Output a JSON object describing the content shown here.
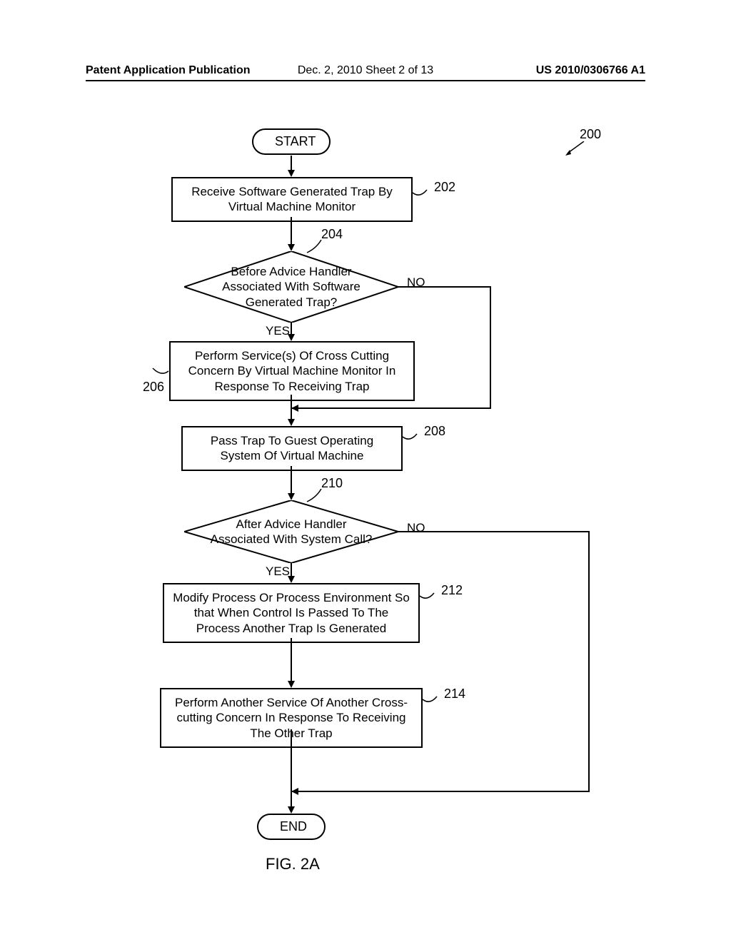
{
  "header": {
    "left": "Patent Application Publication",
    "center": "Dec. 2, 2010  Sheet 2 of 13",
    "right": "US 2010/0306766 A1"
  },
  "nodes": {
    "start": "START",
    "n202": "Receive Software Generated Trap By Virtual Machine Monitor",
    "n204": "Before Advice Handler Associated With Software Generated Trap?",
    "n206": "Perform Service(s) Of Cross Cutting Concern By Virtual Machine Monitor In Response To Receiving Trap",
    "n208": "Pass Trap To Guest Operating System Of Virtual Machine",
    "n210": "After Advice Handler Associated With System Call?",
    "n212": "Modify Process Or Process Environment So that When Control Is Passed To The Process Another Trap Is Generated",
    "n214": "Perform Another Service Of Another Cross-cutting Concern In Response To Receiving The Other Trap",
    "end": "END"
  },
  "labels": {
    "yes": "YES",
    "no": "NO"
  },
  "refs": {
    "r200": "200",
    "r202": "202",
    "r204": "204",
    "r206": "206",
    "r208": "208",
    "r210": "210",
    "r212": "212",
    "r214": "214"
  },
  "figure": "FIG. 2A"
}
